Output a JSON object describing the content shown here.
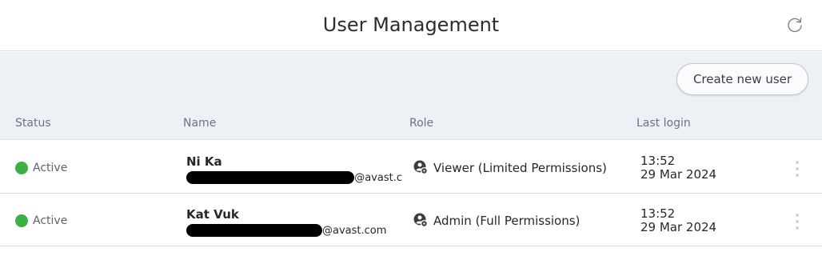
{
  "header": {
    "title": "User Management",
    "refresh_icon": "refresh-icon"
  },
  "toolbar": {
    "create_label": "Create new user"
  },
  "table": {
    "columns": [
      "Status",
      "Name",
      "Role",
      "Last login"
    ],
    "rows": [
      {
        "status": "Active",
        "status_color": "#3cb043",
        "name": "Ni Ka",
        "email_suffix": "@avast.c",
        "role_icon": "user-gear-icon",
        "role": "Viewer (Limited Permissions)",
        "login_time": "13:52",
        "login_date": "29 Mar 2024"
      },
      {
        "status": "Active",
        "status_color": "#3cb043",
        "name": "Kat Vuk",
        "email_suffix": "@avast.com",
        "role_icon": "user-gear-icon",
        "role": "Admin (Full Permissions)",
        "login_time": "13:52",
        "login_date": "29 Mar 2024"
      }
    ]
  }
}
